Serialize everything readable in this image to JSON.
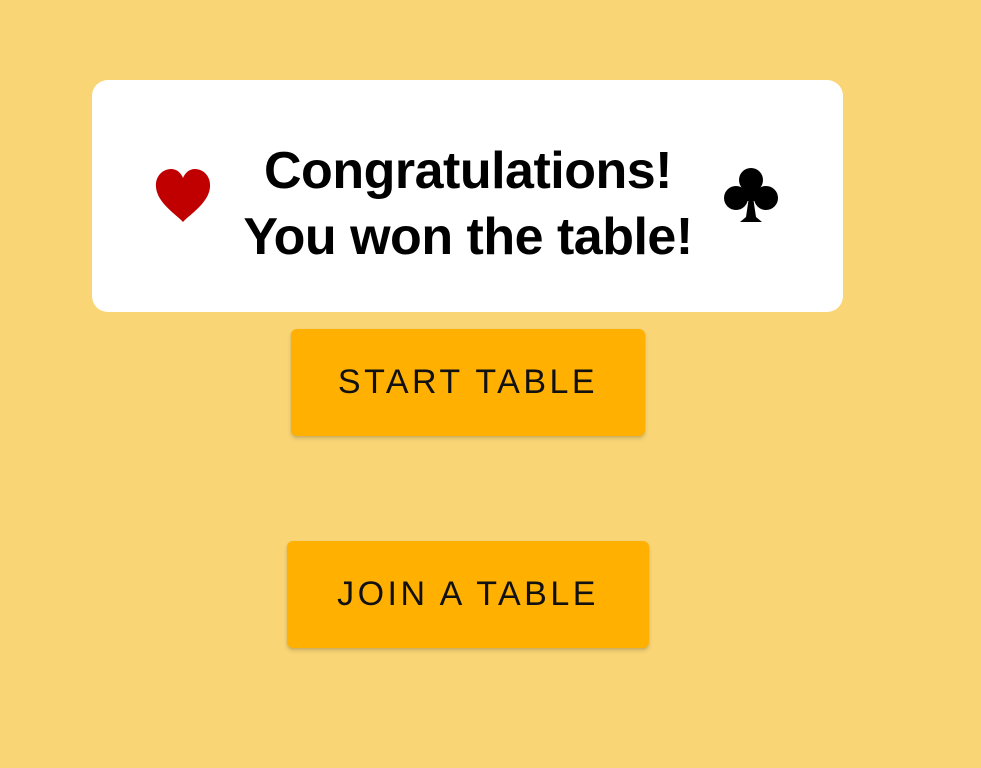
{
  "banner": {
    "line1": "Congratulations!",
    "line2": "You won the table!",
    "left_icon": "heart-icon",
    "right_icon": "club-icon",
    "heart_color": "#C00000",
    "club_color": "#000000"
  },
  "buttons": {
    "start_label": "START TABLE",
    "join_label": "JOIN A TABLE",
    "color": "#FFB000"
  },
  "colors": {
    "background": "#F9D576",
    "banner_background": "#FFFFFF"
  }
}
